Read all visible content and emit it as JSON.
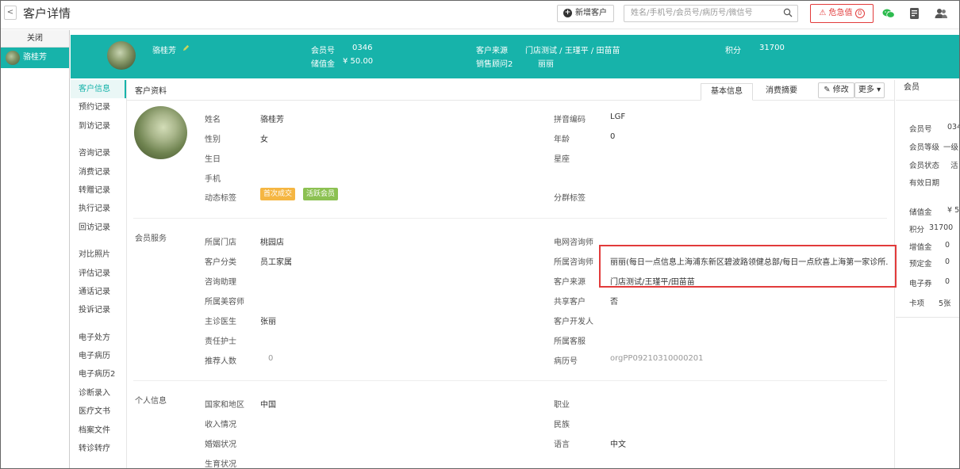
{
  "page": {
    "title": "客户详情",
    "back_label": "<"
  },
  "toolbar": {
    "add_customer_label": "新增客户",
    "search_placeholder": "姓名/手机号/会员号/病历号/微信号",
    "alert_label": "危急值",
    "alert_count": "0"
  },
  "customer_tabs": {
    "close_label": "关闭",
    "current_customer": "骆桂芳"
  },
  "header": {
    "name": "骆桂芳",
    "member_no_label": "会员号",
    "member_no": "0346",
    "balance_label": "储值金",
    "balance": "¥ 50.00",
    "source_label": "客户来源",
    "source": "门店测试 / 王瑾平 / 田苗苗",
    "advisor_label": "销售顾问2",
    "advisor": "丽丽",
    "points_label": "积分",
    "points": "31700"
  },
  "nav": {
    "group1": [
      "客户信息",
      "预约记录",
      "到访记录"
    ],
    "group2": [
      "咨询记录",
      "消费记录",
      "转赠记录",
      "执行记录",
      "回访记录"
    ],
    "group3": [
      "对比照片",
      "评估记录",
      "通话记录",
      "投诉记录"
    ],
    "group4": [
      "电子处方",
      "电子病历",
      "电子病历2",
      "诊断录入",
      "医疗文书",
      "档案文件",
      "转诊转疗"
    ]
  },
  "main": {
    "caption": "客户资料",
    "tab_basic": "基本信息",
    "tab_consume": "消费摘要",
    "edit_label": "修改",
    "more_label": "更多",
    "basic": {
      "name_label": "姓名",
      "name": "骆桂芳",
      "gender_label": "性别",
      "gender": "女",
      "birthday_label": "生日",
      "phone_label": "手机",
      "tags_label": "动态标签",
      "tag1": "首次成交",
      "tag2": "活跃会员",
      "pinyin_label": "拼音编码",
      "pinyin": "LGF",
      "age_label": "年龄",
      "age": "0",
      "zodiac_label": "星座",
      "group_tag_label": "分群标签"
    },
    "member_service": {
      "section_label": "会员服务",
      "store_label": "所属门店",
      "store": "桃园店",
      "category_label": "客户分类",
      "category": "员工家属",
      "assistant_label": "咨询助理",
      "beautician_label": "所属美容师",
      "doctor_label": "主诊医生",
      "doctor": "张丽",
      "nurse_label": "责任护士",
      "referrals_label": "推荐人数",
      "referrals": "0",
      "online_consultant_label": "电网咨询师",
      "consultant_label": "所属咨询师",
      "consultant": "丽丽(每日一点信息上海浦东新区碧波路领健总部/每日一点欣喜上海第一家诊所...",
      "source_label": "客户来源",
      "source": "门店测试/王瑾平/田苗苗",
      "shared_label": "共享客户",
      "shared": "否",
      "developer_label": "客户开发人",
      "service_label": "所属客服",
      "record_no_label": "病历号",
      "record_no": "orgPP09210310000201"
    },
    "personal": {
      "section_label": "个人信息",
      "country_label": "国家和地区",
      "country": "中国",
      "income_label": "收入情况",
      "marital_label": "婚姻状况",
      "birth_label": "生育状况",
      "job_label": "职业",
      "ethnicity_label": "民族",
      "language_label": "语言",
      "language": "中文"
    }
  },
  "right": {
    "title": "会员",
    "member_no_label": "会员号",
    "member_no": "034",
    "level_label": "会员等级",
    "level": "一级",
    "status_label": "会员状态",
    "status": "活",
    "valid_label": "有效日期",
    "balance_label": "储值金",
    "balance": "¥ 5",
    "points_label": "积分",
    "points": "31700",
    "bonus_label": "增值金",
    "bonus": "0",
    "deposit_label": "预定金",
    "deposit": "0",
    "coupon_label": "电子券",
    "coupon": "0",
    "card_label": "卡项",
    "card": "5张"
  },
  "colors": {
    "teal": "#17b3aa",
    "alert_red": "#e23b3b",
    "tag_orange": "#f5b642",
    "tag_green": "#8cc152"
  }
}
